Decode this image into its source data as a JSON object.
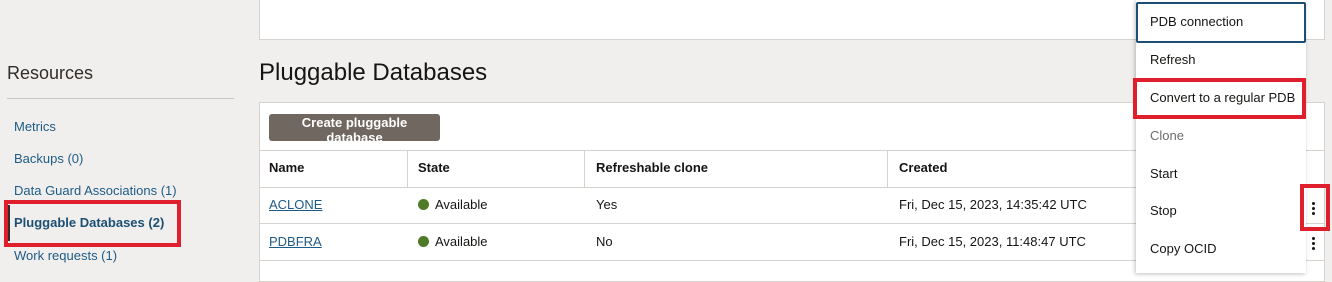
{
  "sidebar": {
    "title": "Resources",
    "items": [
      {
        "label": "Metrics"
      },
      {
        "label": "Backups (0)"
      },
      {
        "label": "Data Guard Associations (1)"
      },
      {
        "label": "Pluggable Databases (2)"
      },
      {
        "label": "Work requests (1)"
      }
    ]
  },
  "main": {
    "title": "Pluggable Databases",
    "create_button": "Create pluggable database",
    "table": {
      "headers": [
        "Name",
        "State",
        "Refreshable clone",
        "Created"
      ],
      "rows": [
        {
          "name": "ACLONE",
          "state": "Available",
          "refreshable": "Yes",
          "created": "Fri, Dec 15, 2023, 14:35:42 UTC"
        },
        {
          "name": "PDBFRA",
          "state": "Available",
          "refreshable": "No",
          "created": "Fri, Dec 15, 2023, 11:48:47 UTC"
        }
      ]
    }
  },
  "actions_menu": {
    "items": [
      {
        "label": "PDB connection",
        "enabled": true
      },
      {
        "label": "Refresh",
        "enabled": true
      },
      {
        "label": "Convert to a regular PDB",
        "enabled": true
      },
      {
        "label": "Clone",
        "enabled": false
      },
      {
        "label": "Start",
        "enabled": true
      },
      {
        "label": "Stop",
        "enabled": true
      },
      {
        "label": "Copy OCID",
        "enabled": true
      }
    ]
  },
  "colors": {
    "highlight": "#e01f2d",
    "link": "#1e5b86",
    "status_available": "#4f7a28",
    "button_bg": "#6f6760"
  },
  "icons": {
    "row_actions": "kebab-menu-icon",
    "status": "status-dot-icon"
  }
}
